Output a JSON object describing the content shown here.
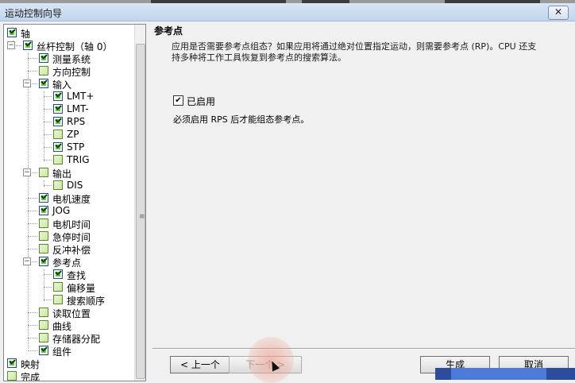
{
  "window": {
    "title": "运动控制向导",
    "close_icon": "close-icon"
  },
  "tree": {
    "items": [
      {
        "label": "轴",
        "checked": true,
        "expander": ""
      },
      {
        "label": "丝杆控制（轴 0）",
        "checked": true,
        "expander": "−"
      },
      {
        "label": "测量系统",
        "checked": true,
        "expander": ""
      },
      {
        "label": "方向控制",
        "checked": false,
        "expander": ""
      },
      {
        "label": "输入",
        "checked": true,
        "expander": "−"
      },
      {
        "label": "LMT+",
        "checked": true,
        "expander": ""
      },
      {
        "label": "LMT-",
        "checked": true,
        "expander": ""
      },
      {
        "label": "RPS",
        "checked": true,
        "expander": ""
      },
      {
        "label": "ZP",
        "checked": false,
        "expander": ""
      },
      {
        "label": "STP",
        "checked": true,
        "expander": ""
      },
      {
        "label": "TRIG",
        "checked": false,
        "expander": ""
      },
      {
        "label": "输出",
        "checked": false,
        "expander": "−"
      },
      {
        "label": "DIS",
        "checked": false,
        "expander": ""
      },
      {
        "label": "电机速度",
        "checked": true,
        "expander": ""
      },
      {
        "label": "JOG",
        "checked": true,
        "expander": ""
      },
      {
        "label": "电机时间",
        "checked": false,
        "expander": ""
      },
      {
        "label": "急停时间",
        "checked": false,
        "expander": ""
      },
      {
        "label": "反冲补偿",
        "checked": false,
        "expander": ""
      },
      {
        "label": "参考点",
        "checked": true,
        "expander": "−"
      },
      {
        "label": "查找",
        "checked": true,
        "expander": ""
      },
      {
        "label": "偏移量",
        "checked": false,
        "expander": ""
      },
      {
        "label": "搜索顺序",
        "checked": false,
        "expander": ""
      },
      {
        "label": "读取位置",
        "checked": false,
        "expander": ""
      },
      {
        "label": "曲线",
        "checked": false,
        "expander": ""
      },
      {
        "label": "存储器分配",
        "checked": false,
        "expander": ""
      },
      {
        "label": "组件",
        "checked": true,
        "expander": ""
      },
      {
        "label": "映射",
        "checked": true,
        "expander": ""
      },
      {
        "label": "完成",
        "checked": false,
        "expander": ""
      }
    ],
    "scroll_grip": "≡"
  },
  "content": {
    "heading": "参考点",
    "description": "应用是否需要参考点组态？如果应用将通过绝对位置指定运动，则需要参考点 (RP)。CPU 还支持多种将工作工具恢复到参考点的搜索算法。",
    "enable_label": "已启用",
    "enable_checked": true,
    "enable_mark": "✔",
    "note": "必须启用 RPS 后才能组态参考点。"
  },
  "buttons": {
    "prev": "< 上一个",
    "next": "下一个 >",
    "generate": "生成",
    "cancel": "取消"
  }
}
